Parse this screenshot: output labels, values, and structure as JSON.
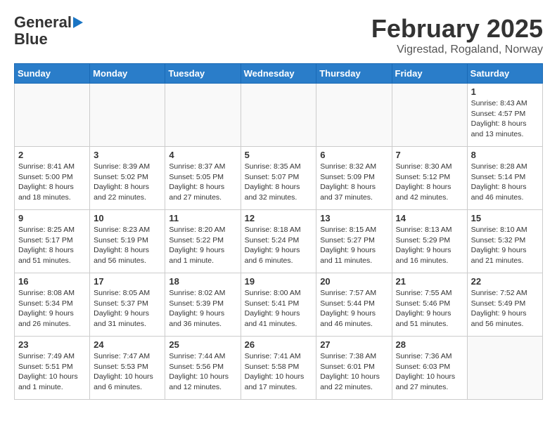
{
  "header": {
    "logo_general": "General",
    "logo_blue": "Blue",
    "month_title": "February 2025",
    "subtitle": "Vigrestad, Rogaland, Norway"
  },
  "days_of_week": [
    "Sunday",
    "Monday",
    "Tuesday",
    "Wednesday",
    "Thursday",
    "Friday",
    "Saturday"
  ],
  "weeks": [
    [
      {
        "day": "",
        "info": ""
      },
      {
        "day": "",
        "info": ""
      },
      {
        "day": "",
        "info": ""
      },
      {
        "day": "",
        "info": ""
      },
      {
        "day": "",
        "info": ""
      },
      {
        "day": "",
        "info": ""
      },
      {
        "day": "1",
        "info": "Sunrise: 8:43 AM\nSunset: 4:57 PM\nDaylight: 8 hours\nand 13 minutes."
      }
    ],
    [
      {
        "day": "2",
        "info": "Sunrise: 8:41 AM\nSunset: 5:00 PM\nDaylight: 8 hours\nand 18 minutes."
      },
      {
        "day": "3",
        "info": "Sunrise: 8:39 AM\nSunset: 5:02 PM\nDaylight: 8 hours\nand 22 minutes."
      },
      {
        "day": "4",
        "info": "Sunrise: 8:37 AM\nSunset: 5:05 PM\nDaylight: 8 hours\nand 27 minutes."
      },
      {
        "day": "5",
        "info": "Sunrise: 8:35 AM\nSunset: 5:07 PM\nDaylight: 8 hours\nand 32 minutes."
      },
      {
        "day": "6",
        "info": "Sunrise: 8:32 AM\nSunset: 5:09 PM\nDaylight: 8 hours\nand 37 minutes."
      },
      {
        "day": "7",
        "info": "Sunrise: 8:30 AM\nSunset: 5:12 PM\nDaylight: 8 hours\nand 42 minutes."
      },
      {
        "day": "8",
        "info": "Sunrise: 8:28 AM\nSunset: 5:14 PM\nDaylight: 8 hours\nand 46 minutes."
      }
    ],
    [
      {
        "day": "9",
        "info": "Sunrise: 8:25 AM\nSunset: 5:17 PM\nDaylight: 8 hours\nand 51 minutes."
      },
      {
        "day": "10",
        "info": "Sunrise: 8:23 AM\nSunset: 5:19 PM\nDaylight: 8 hours\nand 56 minutes."
      },
      {
        "day": "11",
        "info": "Sunrise: 8:20 AM\nSunset: 5:22 PM\nDaylight: 9 hours\nand 1 minute."
      },
      {
        "day": "12",
        "info": "Sunrise: 8:18 AM\nSunset: 5:24 PM\nDaylight: 9 hours\nand 6 minutes."
      },
      {
        "day": "13",
        "info": "Sunrise: 8:15 AM\nSunset: 5:27 PM\nDaylight: 9 hours\nand 11 minutes."
      },
      {
        "day": "14",
        "info": "Sunrise: 8:13 AM\nSunset: 5:29 PM\nDaylight: 9 hours\nand 16 minutes."
      },
      {
        "day": "15",
        "info": "Sunrise: 8:10 AM\nSunset: 5:32 PM\nDaylight: 9 hours\nand 21 minutes."
      }
    ],
    [
      {
        "day": "16",
        "info": "Sunrise: 8:08 AM\nSunset: 5:34 PM\nDaylight: 9 hours\nand 26 minutes."
      },
      {
        "day": "17",
        "info": "Sunrise: 8:05 AM\nSunset: 5:37 PM\nDaylight: 9 hours\nand 31 minutes."
      },
      {
        "day": "18",
        "info": "Sunrise: 8:02 AM\nSunset: 5:39 PM\nDaylight: 9 hours\nand 36 minutes."
      },
      {
        "day": "19",
        "info": "Sunrise: 8:00 AM\nSunset: 5:41 PM\nDaylight: 9 hours\nand 41 minutes."
      },
      {
        "day": "20",
        "info": "Sunrise: 7:57 AM\nSunset: 5:44 PM\nDaylight: 9 hours\nand 46 minutes."
      },
      {
        "day": "21",
        "info": "Sunrise: 7:55 AM\nSunset: 5:46 PM\nDaylight: 9 hours\nand 51 minutes."
      },
      {
        "day": "22",
        "info": "Sunrise: 7:52 AM\nSunset: 5:49 PM\nDaylight: 9 hours\nand 56 minutes."
      }
    ],
    [
      {
        "day": "23",
        "info": "Sunrise: 7:49 AM\nSunset: 5:51 PM\nDaylight: 10 hours\nand 1 minute."
      },
      {
        "day": "24",
        "info": "Sunrise: 7:47 AM\nSunset: 5:53 PM\nDaylight: 10 hours\nand 6 minutes."
      },
      {
        "day": "25",
        "info": "Sunrise: 7:44 AM\nSunset: 5:56 PM\nDaylight: 10 hours\nand 12 minutes."
      },
      {
        "day": "26",
        "info": "Sunrise: 7:41 AM\nSunset: 5:58 PM\nDaylight: 10 hours\nand 17 minutes."
      },
      {
        "day": "27",
        "info": "Sunrise: 7:38 AM\nSunset: 6:01 PM\nDaylight: 10 hours\nand 22 minutes."
      },
      {
        "day": "28",
        "info": "Sunrise: 7:36 AM\nSunset: 6:03 PM\nDaylight: 10 hours\nand 27 minutes."
      },
      {
        "day": "",
        "info": ""
      }
    ]
  ]
}
